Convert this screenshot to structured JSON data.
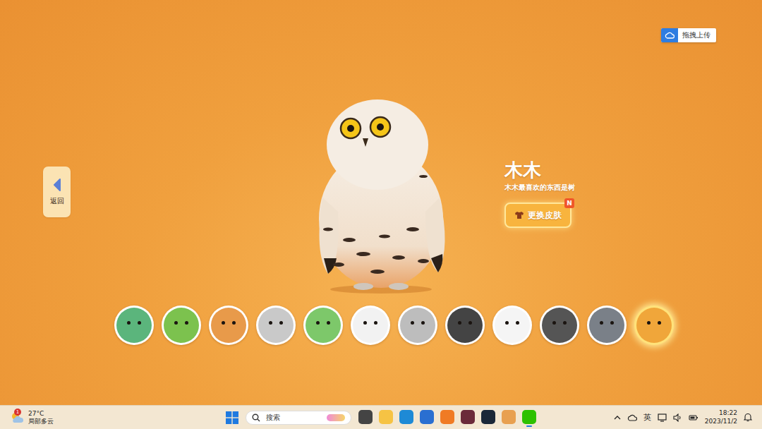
{
  "upload_button": {
    "label": "拖拽上传"
  },
  "back_button": {
    "label": "返回"
  },
  "character": {
    "name": "木木",
    "description": "木木最喜欢的东西是树"
  },
  "skin_button": {
    "label": "更换皮肤",
    "badge": "N"
  },
  "avatars": [
    {
      "selected": false,
      "color": "#5bb57c"
    },
    {
      "selected": false,
      "color": "#7cc24e"
    },
    {
      "selected": false,
      "color": "#e89a4a"
    },
    {
      "selected": false,
      "color": "#c9c9c9"
    },
    {
      "selected": false,
      "color": "#7dc86a"
    },
    {
      "selected": false,
      "color": "#f2f2f2"
    },
    {
      "selected": false,
      "color": "#bdbdbd"
    },
    {
      "selected": false,
      "color": "#444444"
    },
    {
      "selected": false,
      "color": "#f5f5f5"
    },
    {
      "selected": false,
      "color": "#555555"
    },
    {
      "selected": false,
      "color": "#7a8088"
    },
    {
      "selected": true,
      "color": "#f0a63a"
    }
  ],
  "taskbar": {
    "weather": {
      "temperature": "27°C",
      "condition": "局部多云",
      "badge": "1"
    },
    "search": {
      "placeholder": "搜索"
    },
    "apps": [
      {
        "color": "#444444",
        "active": false
      },
      {
        "color": "#f6c344",
        "active": false
      },
      {
        "color": "#1e8ad6",
        "active": false
      },
      {
        "color": "#2a6fd1",
        "active": false
      },
      {
        "color": "#f07b24",
        "active": false
      },
      {
        "color": "#6b2a3a",
        "active": false
      },
      {
        "color": "#1b2838",
        "active": false
      },
      {
        "color": "#e8a050",
        "active": false
      },
      {
        "color": "#2dc100",
        "active": true
      }
    ],
    "tray": {
      "ime": "英",
      "time": "18:22",
      "date": "2023/11/2"
    }
  }
}
